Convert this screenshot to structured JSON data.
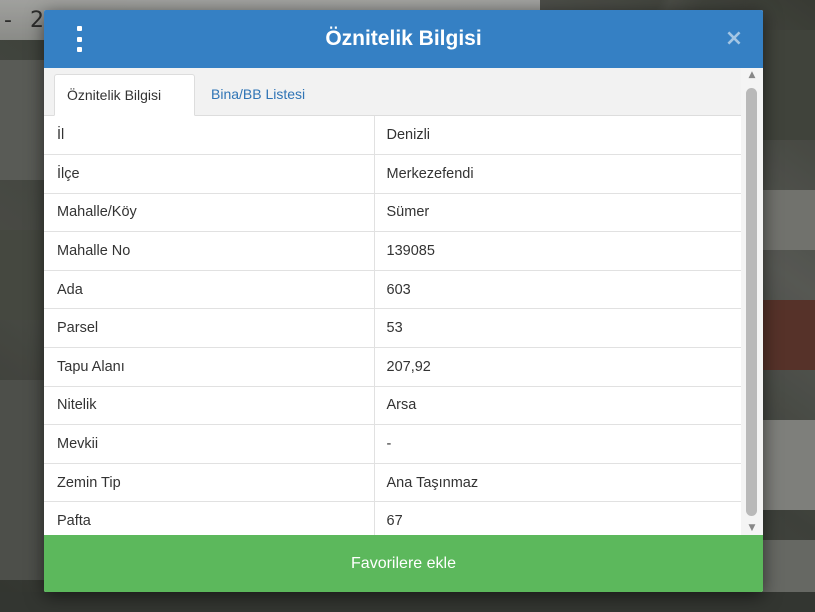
{
  "modal": {
    "title": "Öznitelik Bilgisi",
    "menu_icon": "vertical-dots-icon",
    "close_icon": "close-icon",
    "close_glyph": "×"
  },
  "tabs": [
    {
      "label": "Öznitelik Bilgisi",
      "active": true
    },
    {
      "label": "Bina/BB Listesi",
      "active": false
    }
  ],
  "attributes": [
    {
      "key": "İl",
      "value": "Denizli"
    },
    {
      "key": "İlçe",
      "value": "Merkezefendi"
    },
    {
      "key": "Mahalle/Köy",
      "value": "Sümer"
    },
    {
      "key": "Mahalle No",
      "value": "139085"
    },
    {
      "key": "Ada",
      "value": "603"
    },
    {
      "key": "Parsel",
      "value": "53"
    },
    {
      "key": "Tapu Alanı",
      "value": "207,92"
    },
    {
      "key": "Nitelik",
      "value": "Arsa"
    },
    {
      "key": "Mevkii",
      "value": "-"
    },
    {
      "key": "Zemin Tip",
      "value": "Ana Taşınmaz"
    },
    {
      "key": "Pafta",
      "value": "67"
    }
  ],
  "footer": {
    "favorite_label": "Favorilere ekle"
  },
  "colors": {
    "header": "#3580c4",
    "tab_link": "#2f74b5",
    "favorite_button": "#5cb85c"
  }
}
